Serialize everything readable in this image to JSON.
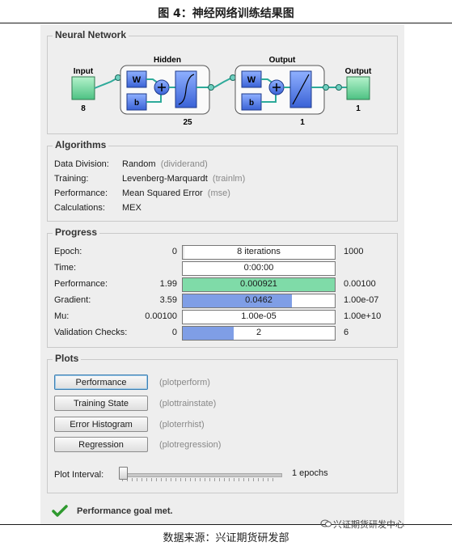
{
  "figure_title": "图 4：神经网络训练结果图",
  "network": {
    "title": "Neural Network",
    "input_label": "Input",
    "input_size": "8",
    "hidden_label": "Hidden",
    "hidden_size": "25",
    "output_layer_label": "Output",
    "output_layer_size": "1",
    "output_label": "Output",
    "output_size": "1",
    "weight_label": "W",
    "bias_label": "b"
  },
  "algorithms": {
    "title": "Algorithms",
    "rows": [
      {
        "key": "Data Division:",
        "value": "Random",
        "fn": "(dividerand)"
      },
      {
        "key": "Training:",
        "value": "Levenberg-Marquardt",
        "fn": "(trainlm)"
      },
      {
        "key": "Performance:",
        "value": "Mean Squared Error",
        "fn": "(mse)"
      },
      {
        "key": "Calculations:",
        "value": "MEX",
        "fn": ""
      }
    ]
  },
  "progress": {
    "title": "Progress",
    "rows": [
      {
        "label": "Epoch:",
        "min": "0",
        "value": "8 iterations",
        "max": "1000",
        "fill": 0.008,
        "color": "#e6e6e6"
      },
      {
        "label": "Time:",
        "min": "",
        "value": "0:00:00",
        "max": "",
        "fill": 0,
        "color": "#ffffff"
      },
      {
        "label": "Performance:",
        "min": "1.99",
        "value": "0.000921",
        "max": "0.00100",
        "fill": 1.0,
        "color": "#7fdba8"
      },
      {
        "label": "Gradient:",
        "min": "3.59",
        "value": "0.0462",
        "max": "1.00e-07",
        "fill": 0.72,
        "color": "#7f9ee6"
      },
      {
        "label": "Mu:",
        "min": "0.00100",
        "value": "1.00e-05",
        "max": "1.00e+10",
        "fill": 0.0,
        "color": "#7f9ee6"
      },
      {
        "label": "Validation Checks:",
        "min": "0",
        "value": "2",
        "max": "6",
        "fill": 0.333,
        "color": "#7f9ee6"
      }
    ]
  },
  "plots": {
    "title": "Plots",
    "buttons": [
      {
        "label": "Performance",
        "fn": "(plotperform)"
      },
      {
        "label": "Training State",
        "fn": "(plottrainstate)"
      },
      {
        "label": "Error Histogram",
        "fn": "(ploterrhist)"
      },
      {
        "label": "Regression",
        "fn": "(plotregression)"
      }
    ],
    "interval_label": "Plot Interval:",
    "interval_value": "1 epochs"
  },
  "status": "Performance goal met.",
  "footer": "数据来源：兴证期货研发部",
  "watermark": "兴证期货研发中心"
}
